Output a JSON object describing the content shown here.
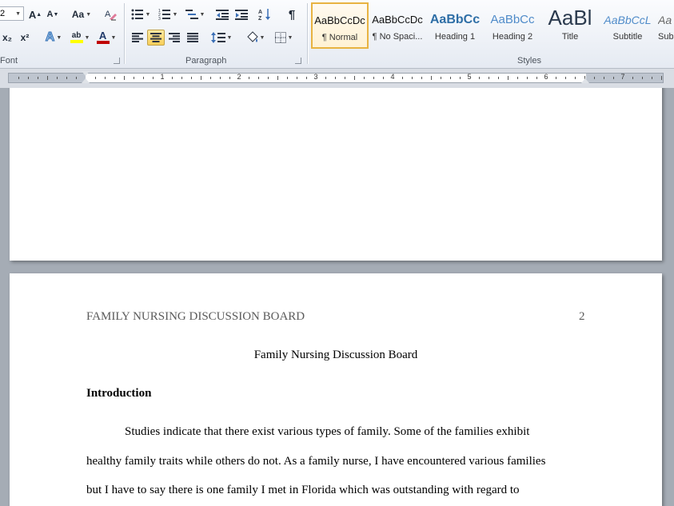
{
  "ribbon": {
    "font_group": {
      "label": "Font",
      "font_size": "2",
      "grow_label": "A",
      "shrink_label": "A",
      "change_case_label": "Aa",
      "subscript_label": "x₂",
      "superscript_label": "x²",
      "text_effects_label": "A",
      "font_color_label": "A",
      "highlight_label": "ab"
    },
    "paragraph_group": {
      "label": "Paragraph",
      "show_marks_label": "¶",
      "sort_label": "A↓Z"
    },
    "styles_group": {
      "label": "Styles",
      "items": [
        {
          "sample": "AaBbCcDc",
          "name": "¶ Normal"
        },
        {
          "sample": "AaBbCcDc",
          "name": "¶ No Spaci..."
        },
        {
          "sample": "AaBbCc",
          "name": "Heading 1"
        },
        {
          "sample": "AaBbCc",
          "name": "Heading 2"
        },
        {
          "sample": "AaBl",
          "name": "Title"
        },
        {
          "sample": "AaBbCcL",
          "name": "Subtitle"
        },
        {
          "sample": "Aa",
          "name": "Sub"
        }
      ]
    },
    "colors": {
      "accent_selected": "#e8b341",
      "font_color": "#c00000",
      "highlight_color": "#ffff00",
      "heading_blue": "#2e6ea6"
    }
  },
  "ruler": {
    "numbers": [
      "1",
      "2",
      "3",
      "4",
      "5",
      "6",
      "7"
    ]
  },
  "document": {
    "header": {
      "running_head": "FAMILY NURSING DISCUSSION BOARD",
      "page_number": "2"
    },
    "title": "Family Nursing Discussion Board",
    "section_heading": "Introduction",
    "paragraph_lines": [
      "Studies indicate that there exist various types of family.  Some of the families  exhibit",
      "healthy family traits while others do not. As a family nurse, I have encountered various families",
      "but I have to say there is one family I met in Florida which was outstanding with regard to"
    ]
  }
}
